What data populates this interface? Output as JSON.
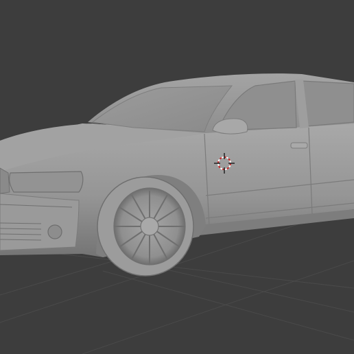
{
  "viewport": {
    "mode": "3d-viewport-solid-shading",
    "background_color": "#3d3d3d",
    "grid_color": "#4a4a4a",
    "x_axis_color": "#8a3a3a",
    "model_base_color": "#9a9a9a",
    "model_shadow_color": "#6f6f6f",
    "model_highlight_color": "#b4b4b4"
  },
  "objects": [
    {
      "name": "car-model",
      "kind": "mesh"
    },
    {
      "name": "3d-cursor-icon",
      "kind": "cursor"
    }
  ]
}
